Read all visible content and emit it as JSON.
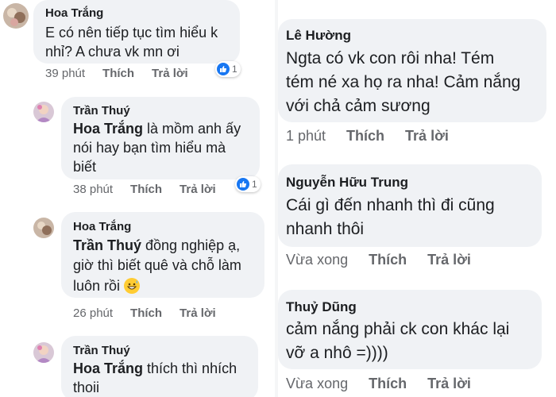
{
  "left_comments": [
    {
      "author": "Hoa Trắng",
      "lines": [
        "E có nên tiếp tục tìm hiểu k",
        "nhỉ? A chưa vk mn ơi"
      ],
      "time": "39 phút",
      "like": "Thích",
      "reply": "Trả lời",
      "reactions": "1"
    },
    {
      "author": "Trần Thuý",
      "mention": "Hoa Trắng",
      "line1_rest": " là mồm anh ấy",
      "lines": [
        "nói hay bạn tìm hiểu mà",
        "biết"
      ],
      "time": "38 phút",
      "like": "Thích",
      "reply": "Trả lời",
      "reactions": "1"
    },
    {
      "author": "Hoa Trắng",
      "mention": "Trần Thuý",
      "line1_rest": "  đồng nghiệp ạ,",
      "lines": [
        "giờ thì biết quê và chỗ làm",
        "luôn rồi"
      ],
      "time": "26 phút",
      "like": "Thích",
      "reply": "Trả lời"
    },
    {
      "author": "Trần Thuý",
      "mention": "Hoa Trắng",
      "line1_rest": " thích thì nhích",
      "lines": [
        "thoii"
      ]
    }
  ],
  "right_comments": [
    {
      "author": "Lê Hường",
      "lines": [
        "Ngta có vk con rôi nha! Tém",
        "tém né xa họ ra nha! Cảm nắng",
        "với chả cảm sương"
      ],
      "time": "1 phút",
      "like": "Thích",
      "reply": "Trả lời"
    },
    {
      "author": "Nguyễn Hữu Trung",
      "lines": [
        "Cái gì đến nhanh thì đi cũng",
        "nhanh thôi"
      ],
      "time": "Vừa xong",
      "like": "Thích",
      "reply": "Trả lời"
    },
    {
      "author": "Thuỷ Dũng",
      "lines": [
        "cảm nắng phải ck con khác lại",
        "vỡ a nhô =))))"
      ],
      "time": "Vừa xong",
      "like": "Thích",
      "reply": "Trả lời"
    }
  ],
  "icons": {
    "reaction": "like-icon",
    "emoji": "grinning-sweat-emoji"
  },
  "colors": {
    "bubble": "#f0f2f5",
    "meta": "#65676b",
    "like_blue": "#1877f2"
  }
}
